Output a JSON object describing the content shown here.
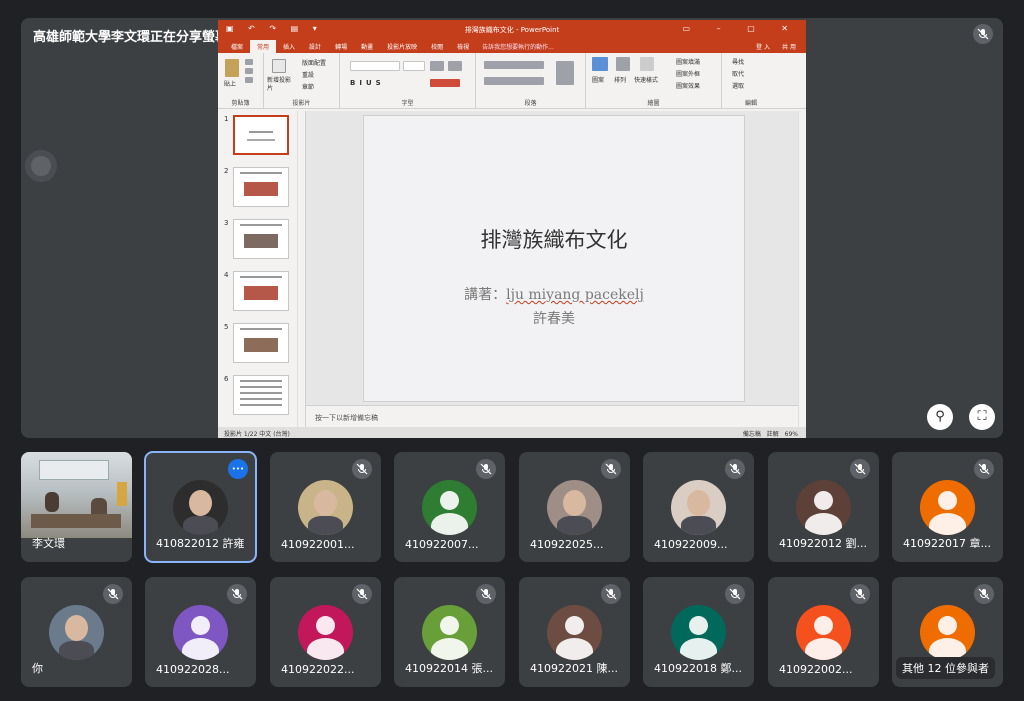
{
  "presenter_label": "高雄師範大學李文環正在分享螢幕畫面",
  "powerpoint": {
    "window_title": "排灣族織布文化 - PowerPoint",
    "tabs": [
      "檔案",
      "常用",
      "插入",
      "設計",
      "轉場",
      "動畫",
      "投影片放映",
      "校閱",
      "檢視"
    ],
    "tell_me": "告訴我您想要執行的動作...",
    "account": "登入",
    "share": "共用",
    "ribbon_groups": [
      "剪貼簿",
      "投影片",
      "字型",
      "段落",
      "繪圖",
      "編輯"
    ],
    "ribbon_items": {
      "paste": "貼上",
      "new_slide": "新增投影片",
      "layout": "版面配置",
      "reset": "重設",
      "section": "章節",
      "shapes": "圖案",
      "arrange": "排列",
      "quick_styles": "快速樣式",
      "shape_fill": "圖案填滿",
      "shape_outline": "圖案外框",
      "shape_effects": "圖案效果",
      "find": "尋找",
      "replace": "取代",
      "select": "選取"
    },
    "thumbnail_numbers": [
      "1",
      "2",
      "3",
      "4",
      "5",
      "6"
    ],
    "slide": {
      "title": "排灣族織布文化",
      "speaker_prefix": "講著：",
      "speaker_name": "lju miyang  pacekelj",
      "speaker_line2": "許春美"
    },
    "notes_placeholder": "按一下以新增備忘稿",
    "status_left": "投影片 1/22   中文 (台灣)",
    "status_right": "備忘稿  註解   69%"
  },
  "participants": [
    {
      "name": "李文環",
      "type": "camera",
      "muted": false
    },
    {
      "name": "410822012 許雍",
      "type": "photo",
      "muted": false,
      "selected": true,
      "color": "#2d2d2d"
    },
    {
      "name": "410922001...",
      "type": "photo",
      "muted": true,
      "color": "#c9b48a"
    },
    {
      "name": "410922007...",
      "type": "avatar",
      "muted": true,
      "color": "#2e7d32"
    },
    {
      "name": "410922025...",
      "type": "photo",
      "muted": true,
      "color": "#9e8e86"
    },
    {
      "name": "410922009...",
      "type": "photo",
      "muted": true,
      "color": "#d9cdc4"
    },
    {
      "name": "410922012 劉...",
      "type": "avatar",
      "muted": true,
      "color": "#5d4037"
    },
    {
      "name": "410922017 章...",
      "type": "avatar",
      "muted": true,
      "color": "#ef6c00"
    },
    {
      "name": "你",
      "type": "photo",
      "muted": true,
      "color": "#6b7b8c"
    },
    {
      "name": "410922028...",
      "type": "avatar",
      "muted": true,
      "color": "#7e57c2"
    },
    {
      "name": "410922022...",
      "type": "avatar",
      "muted": true,
      "color": "#c2185b"
    },
    {
      "name": "410922014 張...",
      "type": "avatar",
      "muted": true,
      "color": "#689f38"
    },
    {
      "name": "410922021 陳...",
      "type": "avatar",
      "muted": true,
      "color": "#6d4c41"
    },
    {
      "name": "410922018 鄭...",
      "type": "avatar",
      "muted": true,
      "color": "#00695c"
    },
    {
      "name": "410922002...",
      "type": "avatar",
      "muted": true,
      "color": "#f4511e"
    },
    {
      "name": "其他 12 位參與者",
      "type": "avatar",
      "muted": true,
      "color": "#ef6c00"
    }
  ],
  "icons": {
    "mic_off": "mic-off-icon",
    "pin": "pin-icon",
    "fullscreen": "fullscreen-icon",
    "more": "more-options-icon"
  }
}
